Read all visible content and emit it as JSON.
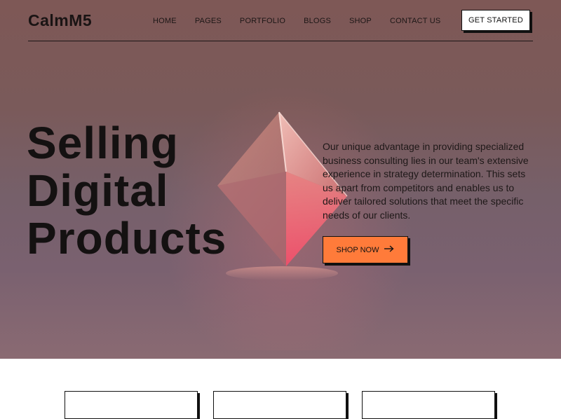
{
  "brand": {
    "logo": "CalmM5"
  },
  "nav": {
    "items": [
      "HOME",
      "PAGES",
      "PORTFOLIO",
      "BLOGS",
      "SHOP",
      "CONTACT US"
    ],
    "cta_label": "GET STARTED"
  },
  "hero": {
    "headline_lines": [
      "Selling",
      "Digital",
      "Products"
    ],
    "description": "Our unique advantage in providing specialized business consulting lies in our team's extensive experience in strategy determination. This sets us apart from competitors and enables us to deliver tailored solutions that meet the specific needs of our clients.",
    "shop_button_label": "SHOP NOW",
    "shop_button_icon": "arrow-right-icon"
  },
  "colors": {
    "accent": "#ff7b3a",
    "text": "#141111",
    "hero_bg": "#7a5a5a"
  }
}
